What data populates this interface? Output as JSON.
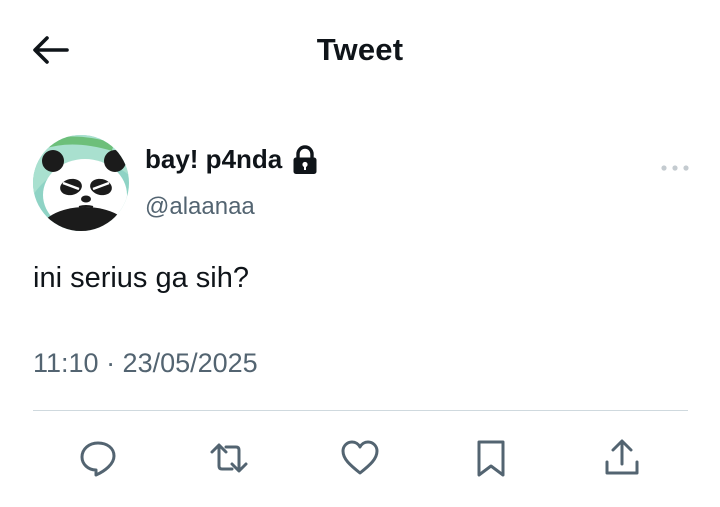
{
  "header": {
    "title": "Tweet",
    "back_icon": "arrow-left-icon"
  },
  "tweet": {
    "author": {
      "display_name": "bay! p4nda",
      "handle": "@alaanaa",
      "protected_icon": "lock-icon",
      "avatar": "panda-avatar"
    },
    "more_icon": "more-horizontal-icon",
    "text": "ini serius ga sih?",
    "timestamp": "11:10 · 23/05/2025"
  },
  "actions": [
    {
      "name": "reply",
      "icon": "reply-icon"
    },
    {
      "name": "retweet",
      "icon": "retweet-icon"
    },
    {
      "name": "like",
      "icon": "heart-icon"
    },
    {
      "name": "bookmark",
      "icon": "bookmark-icon"
    },
    {
      "name": "share",
      "icon": "share-icon"
    }
  ],
  "colors": {
    "text_primary": "#0f1419",
    "text_secondary": "#536471",
    "divider": "#cfd9de",
    "icon": "#536471"
  }
}
